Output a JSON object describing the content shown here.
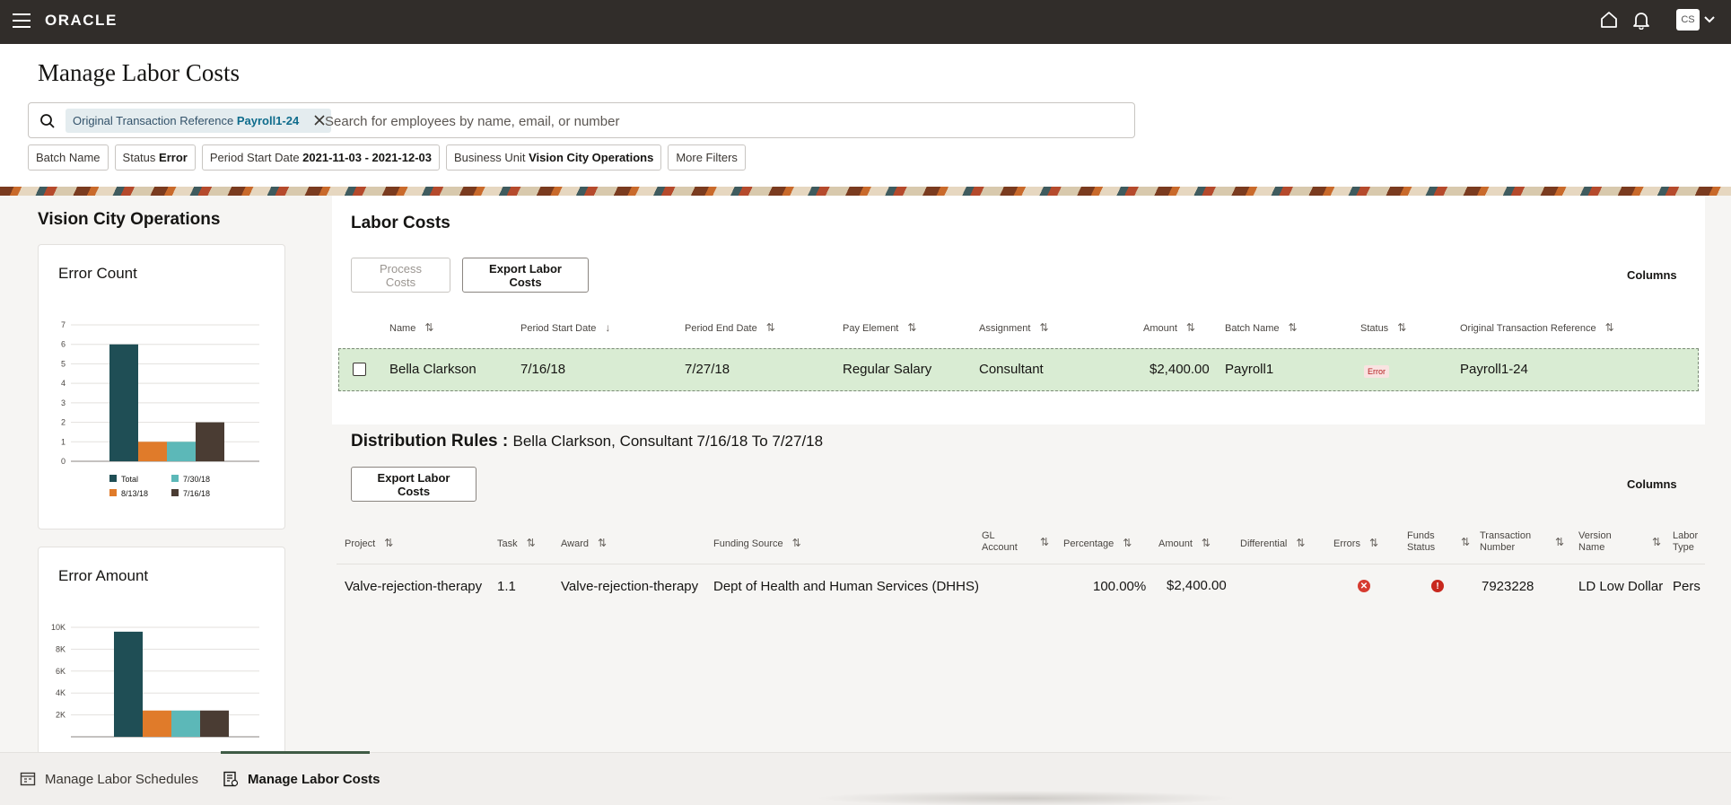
{
  "app": {
    "brand": "ORACLE",
    "user_initials": "CS"
  },
  "page": {
    "title": "Manage Labor Costs"
  },
  "search": {
    "chip_label": "Original Transaction Reference",
    "chip_value": "Payroll1-24",
    "placeholder": "Search for employees by name, email, or number"
  },
  "filters": [
    {
      "label": "Batch Name",
      "value": ""
    },
    {
      "label": "Status",
      "value": "Error"
    },
    {
      "label": "Period Start Date",
      "value": "2021-11-03 - 2021-12-03"
    },
    {
      "label": "Business Unit",
      "value": "Vision City Operations"
    },
    {
      "label": "More Filters",
      "value": ""
    }
  ],
  "left_panel": {
    "title": "Vision City Operations",
    "error_count_title": "Error Count",
    "error_amount_title": "Error Amount"
  },
  "chart_data": [
    {
      "type": "bar",
      "title": "Error Count",
      "categories": [
        "Total",
        "8/13/18",
        "7/30/18",
        "7/16/18"
      ],
      "values": [
        6,
        1,
        1,
        2
      ],
      "ylim": [
        0,
        7
      ],
      "yticks": [
        "0",
        "1",
        "2",
        "3",
        "4",
        "5",
        "6",
        "7"
      ],
      "colors": [
        "#1f4e55",
        "#e07b2a",
        "#5cb8b8",
        "#4a3c33"
      ],
      "legend": [
        "Total",
        "7/30/18",
        "8/13/18",
        "7/16/18"
      ],
      "grid": true
    },
    {
      "type": "bar",
      "title": "Error Amount",
      "categories": [
        "Total",
        "8/13/18",
        "7/30/18",
        "7/16/18"
      ],
      "values": [
        9600,
        2400,
        2400,
        2400
      ],
      "ylim": [
        0,
        10000
      ],
      "yticks": [
        "2K",
        "4K",
        "6K",
        "8K",
        "10K"
      ],
      "colors": [
        "#1f4e55",
        "#e07b2a",
        "#5cb8b8",
        "#4a3c33"
      ],
      "grid": true
    }
  ],
  "labor_costs": {
    "title": "Labor Costs",
    "process_label": "Process Costs",
    "export_label": "Export Labor Costs",
    "columns_label": "Columns",
    "headers": [
      "Name",
      "Period Start Date",
      "Period End Date",
      "Pay Element",
      "Assignment",
      "Amount",
      "Batch Name",
      "Status",
      "Original Transaction Reference"
    ],
    "row": {
      "name": "Bella Clarkson",
      "period_start": "7/16/18",
      "period_end": "7/27/18",
      "pay_element": "Regular Salary",
      "assignment": "Consultant",
      "amount": "$2,400.00",
      "batch_name": "Payroll1",
      "status": "Error",
      "orig_ref": "Payroll1-24"
    }
  },
  "distribution": {
    "title": "Distribution Rules :",
    "subtitle": "Bella Clarkson, Consultant 7/16/18 To 7/27/18",
    "export_label": "Export Labor Costs",
    "columns_label": "Columns",
    "headers": {
      "project": "Project",
      "task": "Task",
      "award": "Award",
      "funding": "Funding Source",
      "gl_1": "GL",
      "gl_2": "Account",
      "percentage": "Percentage",
      "amount": "Amount",
      "differential": "Differential",
      "errors": "Errors",
      "funds_1": "Funds",
      "funds_2": "Status",
      "txn_1": "Transaction",
      "txn_2": "Number",
      "version_1": "Version",
      "version_2": "Name",
      "labor_1": "Labor",
      "labor_2": "Type"
    },
    "row": {
      "project": "Valve-rejection-therapy",
      "task": "1.1",
      "award": "Valve-rejection-therapy",
      "funding": "Dept of Health and Human Services (DHHS)",
      "percentage": "100.00%",
      "amount": "$2,400.00",
      "txn_number": "7923228",
      "version": "LD Low Dollar",
      "labor_type": "Pers"
    }
  },
  "dock": {
    "item1": "Manage Labor Schedules",
    "item2": "Manage Labor Costs"
  }
}
